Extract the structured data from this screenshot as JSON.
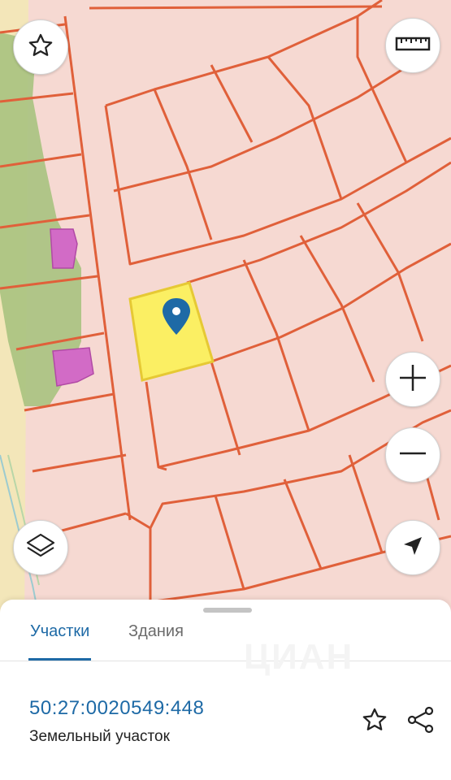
{
  "map": {
    "buttons": {
      "favorite_icon": "star-outline-icon",
      "ruler_icon": "ruler-icon",
      "zoom_in_icon": "plus-icon",
      "zoom_out_icon": "minus-icon",
      "layers_icon": "layers-icon",
      "locate_icon": "navigation-arrow-icon"
    },
    "colors": {
      "background": "#f6d9d2",
      "parcel_border": "#e0603a",
      "green_area": "#a9c27f",
      "building": "#d26bc6",
      "selected_parcel": "#fbef63",
      "pin": "#1e6aa6"
    }
  },
  "sheet": {
    "tabs": [
      {
        "label": "Участки",
        "active": true
      },
      {
        "label": "Здания",
        "active": false
      }
    ],
    "cadastral_number": "50:27:0020549:448",
    "parcel_type": "Земельный участок",
    "actions": {
      "favorite_icon": "star-outline-icon",
      "share_icon": "share-icon"
    },
    "watermark": "ЦИАН"
  }
}
